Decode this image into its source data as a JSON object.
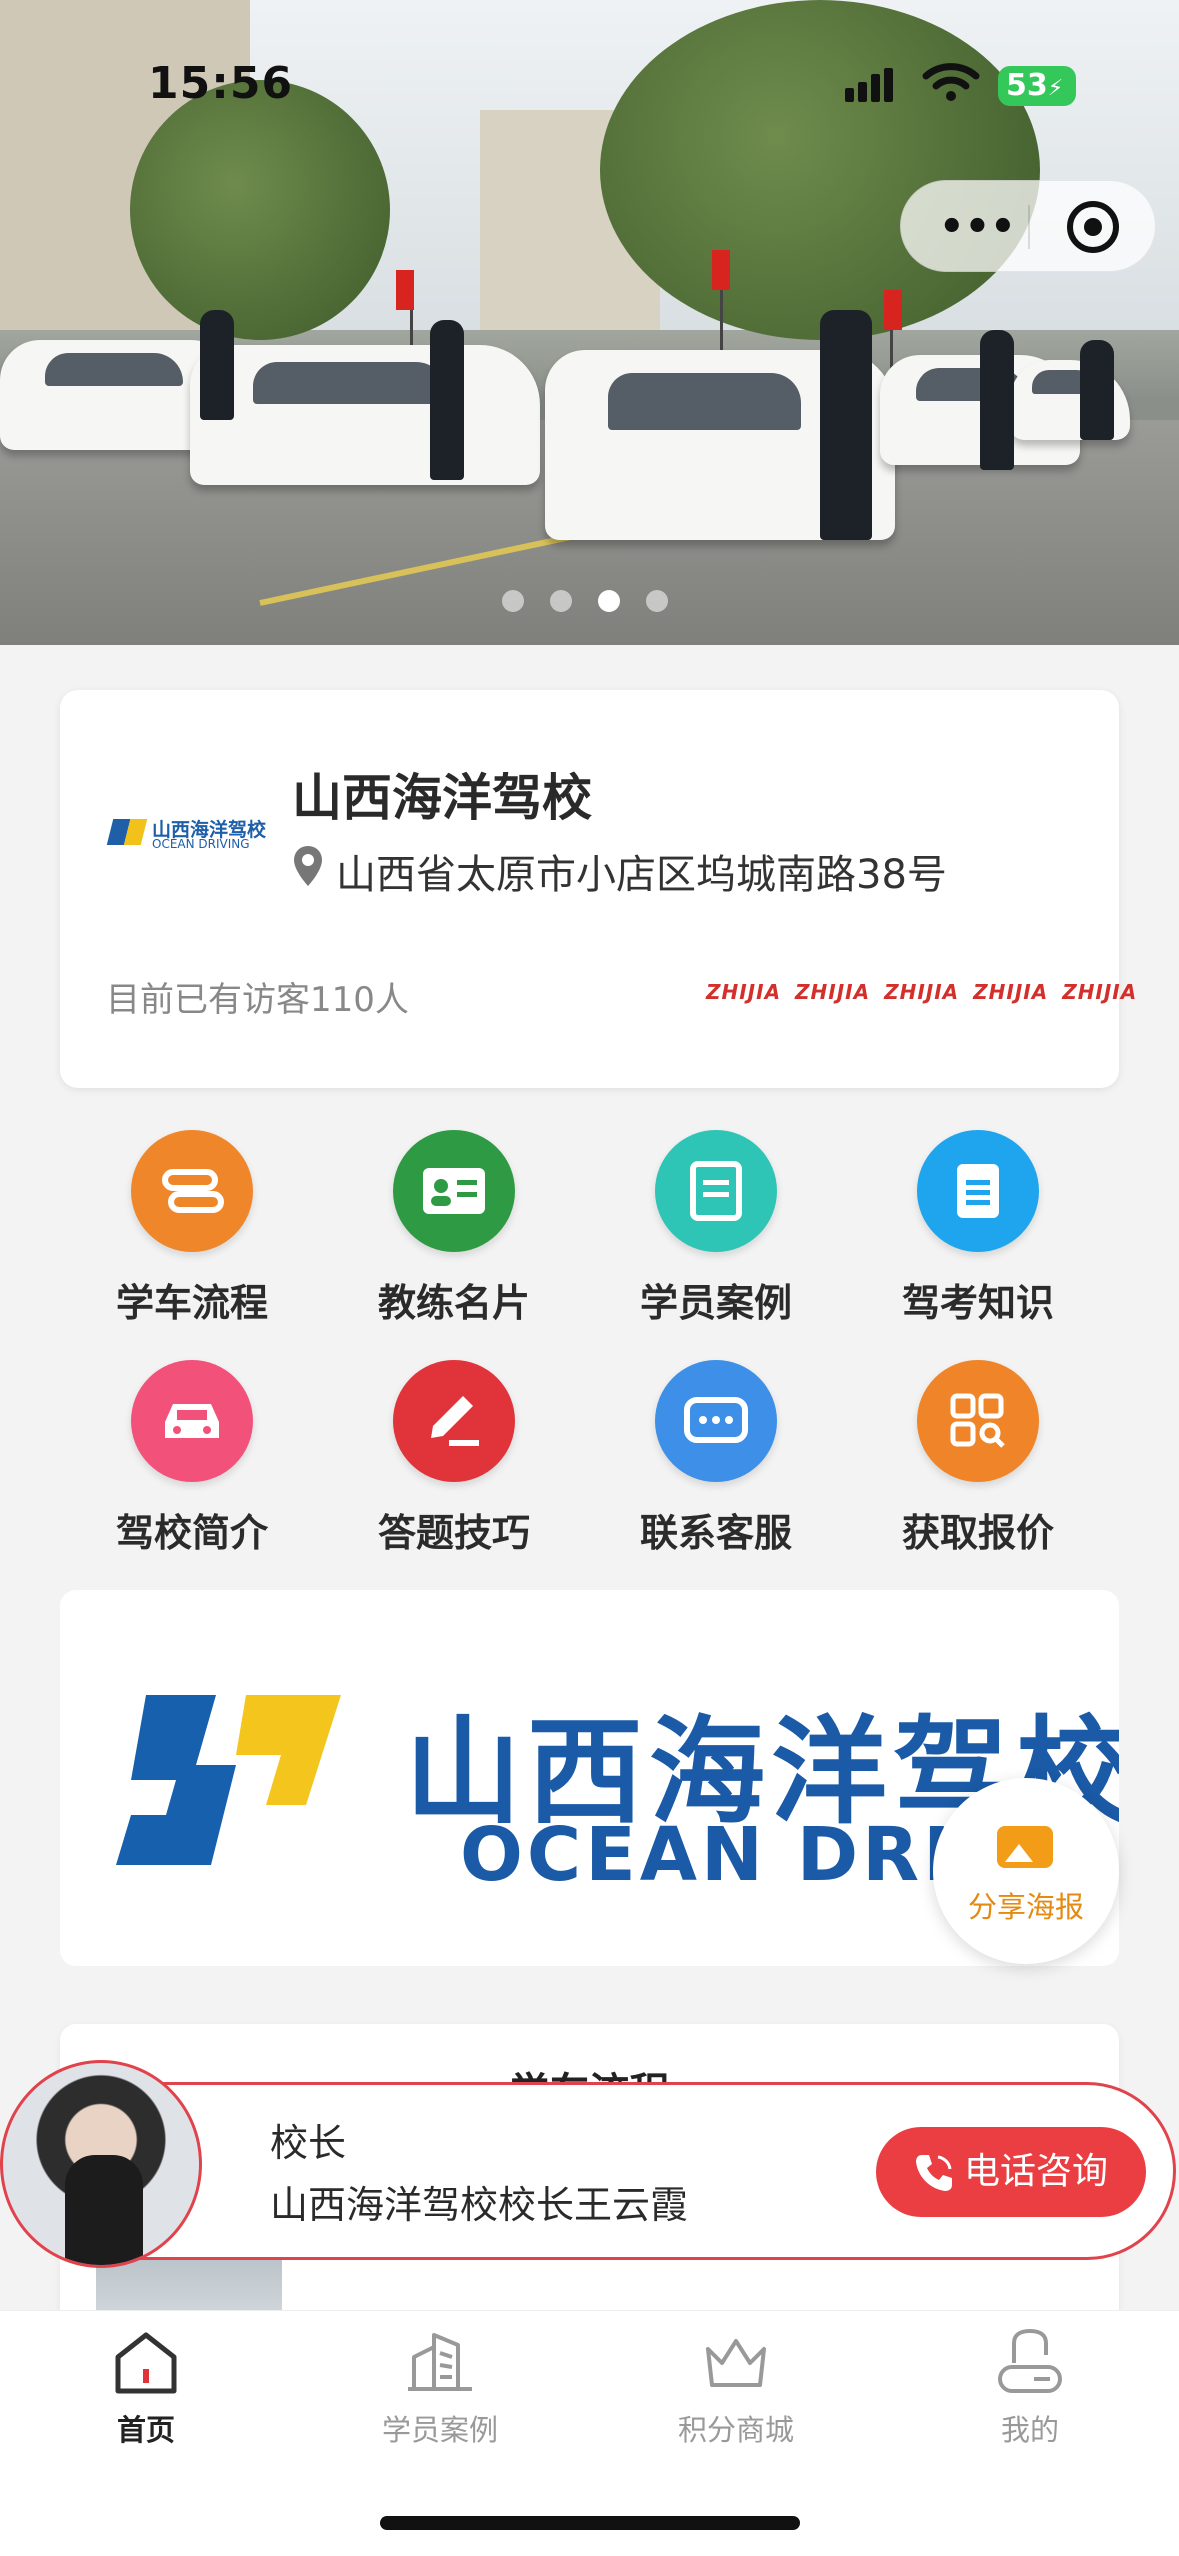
{
  "status": {
    "time": "15:56",
    "battery": "53"
  },
  "carousel": {
    "count": 4,
    "active_index": 2
  },
  "school": {
    "name": "山西海洋驾校",
    "address": "山西省太原市小店区坞城南路38号",
    "visitors": "目前已有访客110人",
    "logo_cn": "山西海洋驾校",
    "logo_en": "OCEAN DRIVING",
    "brand_marks": [
      "ZHIJIA",
      "ZHIJIA",
      "ZHIJIA",
      "ZHIJIA",
      "ZHIJIA"
    ]
  },
  "menu": [
    {
      "label": "学车流程",
      "icon": "flow-icon",
      "color": "#f0862a"
    },
    {
      "label": "教练名片",
      "icon": "id-card-icon",
      "color": "#2f9a44"
    },
    {
      "label": "学员案例",
      "icon": "book-icon",
      "color": "#2ec4b6"
    },
    {
      "label": "驾考知识",
      "icon": "document-icon",
      "color": "#1ea5ee"
    },
    {
      "label": "驾校简介",
      "icon": "car-icon",
      "color": "#f2527a"
    },
    {
      "label": "答题技巧",
      "icon": "pencil-icon",
      "color": "#e0343a"
    },
    {
      "label": "联系客服",
      "icon": "chat-icon",
      "color": "#3d8fe8"
    },
    {
      "label": "获取报价",
      "icon": "grid-search-icon",
      "color": "#ef8428"
    }
  ],
  "banner": {
    "title": "山西海洋驾校",
    "subtitle": "OCEAN DRIVI"
  },
  "share": {
    "label": "分享海报"
  },
  "section": {
    "title": "学车流程"
  },
  "contact": {
    "role": "校长",
    "name": "山西海洋驾校校长王云霞",
    "button": "电话咨询",
    "border_color": "#e0434b"
  },
  "tabs": [
    {
      "label": "首页",
      "icon": "home-icon",
      "active": true
    },
    {
      "label": "学员案例",
      "icon": "building-icon",
      "active": false
    },
    {
      "label": "积分商城",
      "icon": "crown-icon",
      "active": false
    },
    {
      "label": "我的",
      "icon": "user-icon",
      "active": false
    }
  ]
}
